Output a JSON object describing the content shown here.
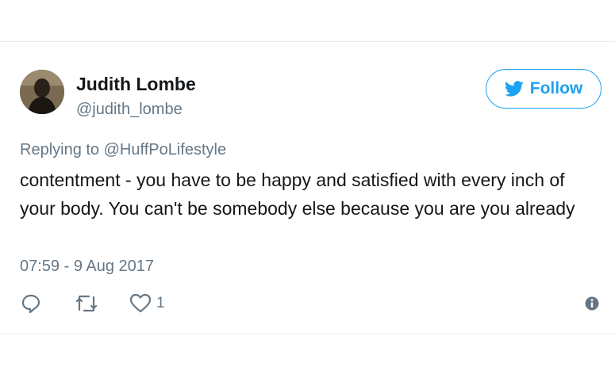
{
  "tweet": {
    "display_name": "Judith Lombe",
    "handle": "@judith_lombe",
    "follow_label": "Follow",
    "replying_prefix": "Replying to",
    "replying_to": "@HuffPoLifestyle",
    "text": "contentment - you have to be happy and satisfied with every inch of your body. You can't be somebody else because you are you already",
    "timestamp": "07:59 - 9 Aug 2017",
    "like_count": "1"
  },
  "icons": {
    "follow": "twitter-bird-icon",
    "reply": "reply-icon",
    "retweet": "retweet-icon",
    "like": "heart-icon",
    "info": "info-icon"
  },
  "colors": {
    "accent": "#1da1f2",
    "text_primary": "#14171a",
    "text_secondary": "#657786",
    "divider": "#e6ecf0"
  }
}
